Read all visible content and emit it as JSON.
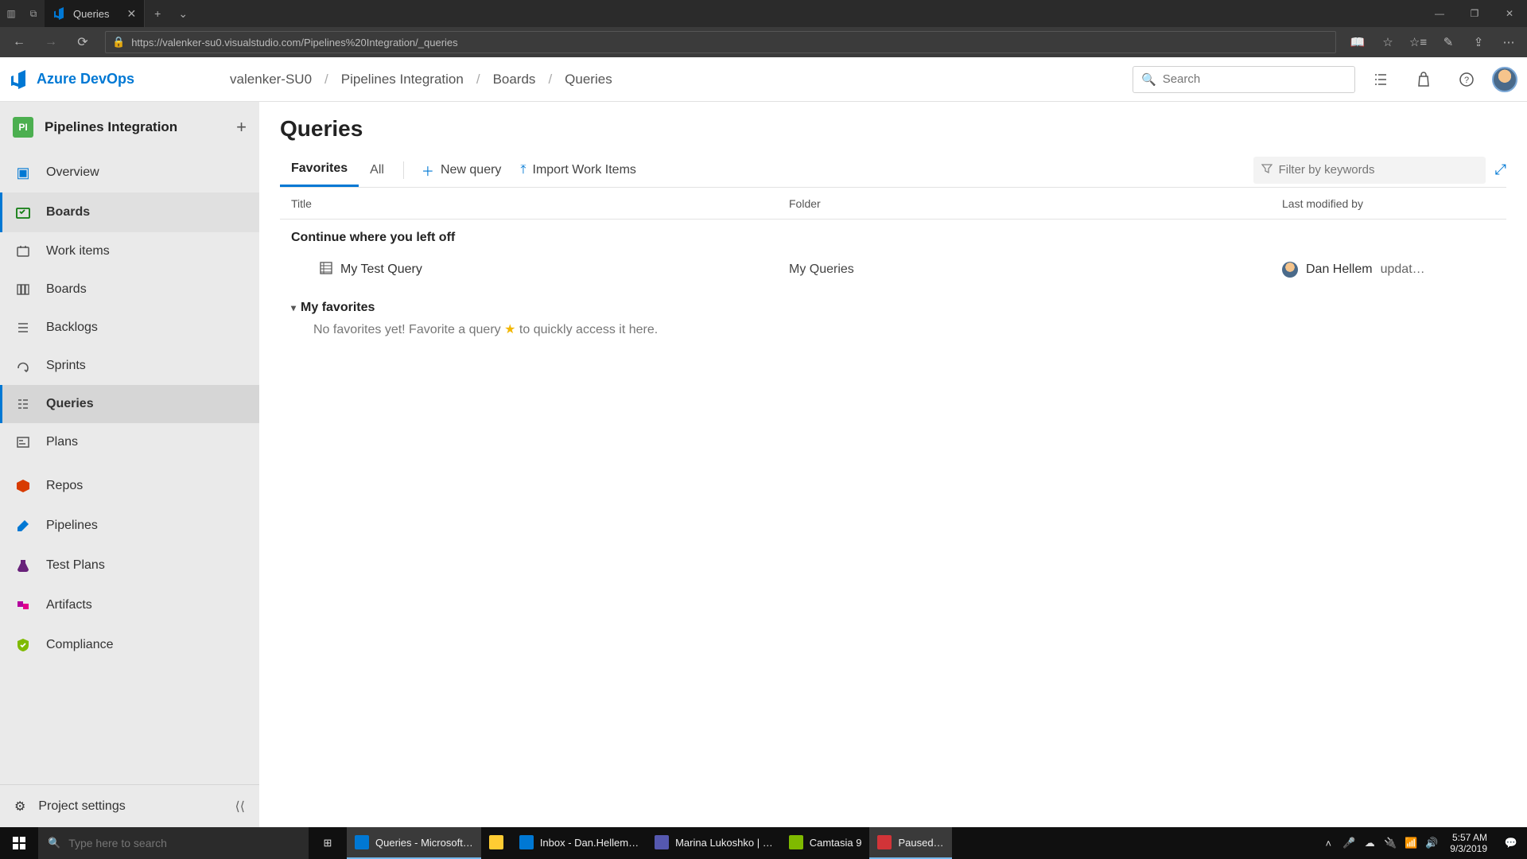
{
  "browser": {
    "tab_title": "Queries",
    "url": "https://valenker-su0.visualstudio.com/Pipelines%20Integration/_queries"
  },
  "header": {
    "brand": "Azure DevOps",
    "breadcrumbs": [
      "valenker-SU0",
      "Pipelines Integration",
      "Boards",
      "Queries"
    ],
    "search_placeholder": "Search"
  },
  "sidebar": {
    "project_badge": "PI",
    "project_name": "Pipelines Integration",
    "items": [
      {
        "label": "Overview"
      },
      {
        "label": "Boards"
      },
      {
        "label": "Work items"
      },
      {
        "label": "Boards"
      },
      {
        "label": "Backlogs"
      },
      {
        "label": "Sprints"
      },
      {
        "label": "Queries"
      },
      {
        "label": "Plans"
      },
      {
        "label": "Repos"
      },
      {
        "label": "Pipelines"
      },
      {
        "label": "Test Plans"
      },
      {
        "label": "Artifacts"
      },
      {
        "label": "Compliance"
      }
    ],
    "project_settings": "Project settings"
  },
  "page": {
    "title": "Queries",
    "tabs": {
      "favorites": "Favorites",
      "all": "All"
    },
    "actions": {
      "new_query": "New query",
      "import": "Import Work Items"
    },
    "filter_placeholder": "Filter by keywords",
    "columns": {
      "title": "Title",
      "folder": "Folder",
      "modified": "Last modified by"
    },
    "continue_section": "Continue where you left off",
    "recent_row": {
      "title": "My Test Query",
      "folder": "My Queries",
      "modified_by": "Dan Hellem",
      "modified_suffix": "updat…"
    },
    "favorites_section": "My favorites",
    "favorites_empty_pre": "No favorites yet! Favorite a query ",
    "favorites_empty_post": " to quickly access it here."
  },
  "taskbar": {
    "search_placeholder": "Type here to search",
    "apps": [
      {
        "label": "Queries - Microsoft…",
        "color": "#0078d4"
      },
      {
        "label": "",
        "color": "#ffcc33"
      },
      {
        "label": "Inbox - Dan.Hellem…",
        "color": "#0078d4"
      },
      {
        "label": "Marina Lukoshko | …",
        "color": "#5558af"
      },
      {
        "label": "Camtasia 9",
        "color": "#7fba00"
      },
      {
        "label": "Paused…",
        "color": "#d13438"
      }
    ],
    "time": "5:57 AM",
    "date": "9/3/2019"
  }
}
